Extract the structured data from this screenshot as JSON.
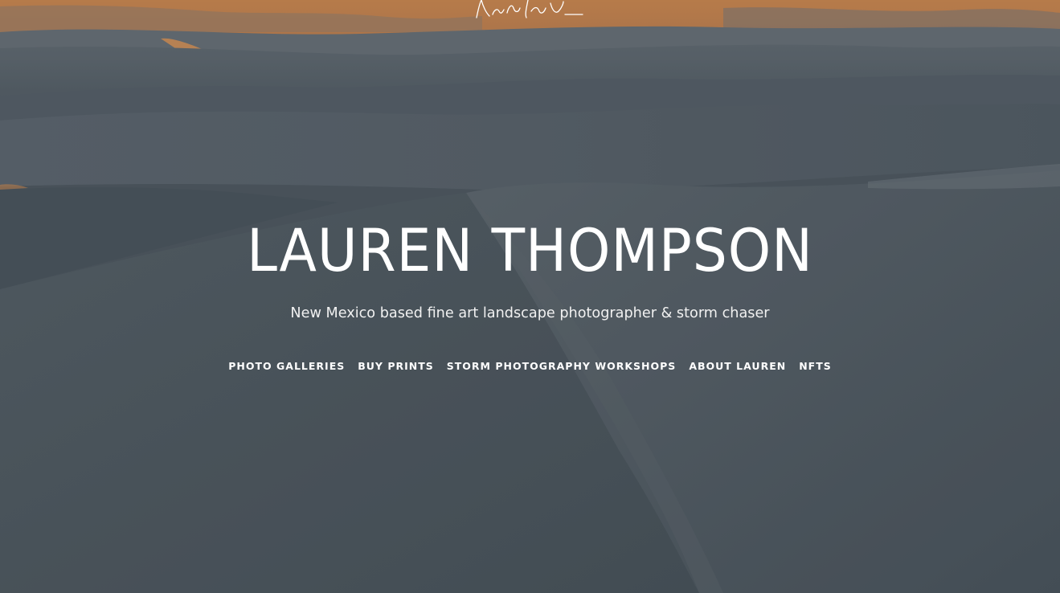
{
  "site": {
    "title": "LAUREN THOMPSON",
    "tagline": "New Mexico based fine art landscape photographer & storm chaser"
  },
  "nav": {
    "items": [
      {
        "label": "PHOTO GALLERIES"
      },
      {
        "label": "BUY PRINTS"
      },
      {
        "label": "STORM PHOTOGRAPHY WORKSHOPS"
      },
      {
        "label": "ABOUT LAUREN"
      },
      {
        "label": "NFTS"
      }
    ]
  },
  "colors": {
    "sky": "#c8834a",
    "dunes": "#4c565e",
    "text": "#ffffff"
  },
  "icons": {
    "logo": "signature-logo"
  }
}
